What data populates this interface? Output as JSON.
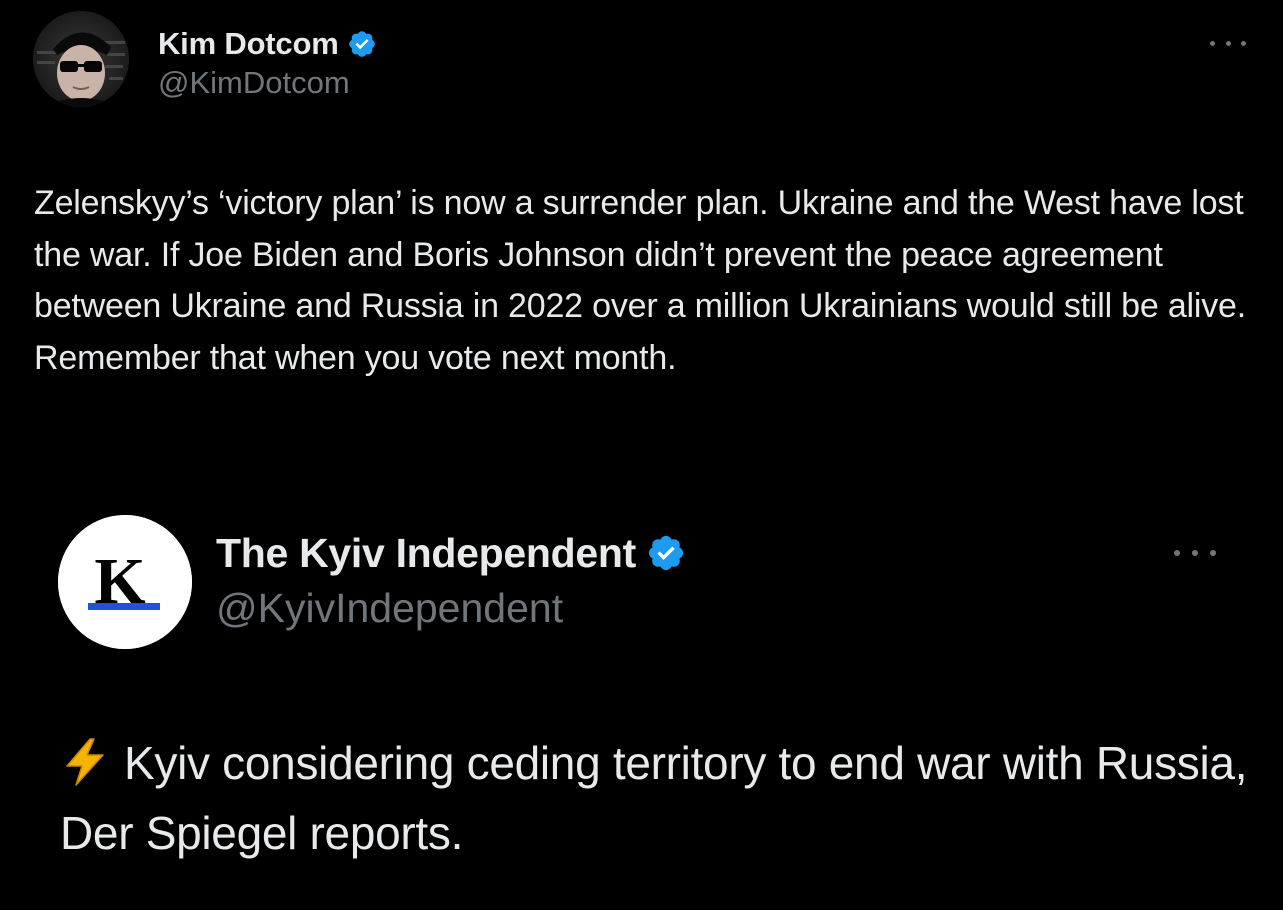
{
  "tweet": {
    "author": {
      "name": "Kim Dotcom",
      "handle": "@KimDotcom",
      "verified": true,
      "avatar_icon": "avatar-photo"
    },
    "more_icon": "more-dots-icon",
    "text": "Zelenskyy’s ‘victory plan’ is now a surrender plan. Ukraine and the West have lost the war. If Joe Biden and Boris Johnson didn’t prevent the peace agreement between Ukraine and Russia in 2022 over a million Ukrainians would still be alive. Remember that when you vote next month."
  },
  "quoted_tweet": {
    "author": {
      "name": "The Kyiv Independent",
      "handle": "@KyivIndependent",
      "verified": true,
      "avatar_letter": "K"
    },
    "more_icon": "more-dots-icon",
    "emoji_icon": "lightning-bolt-icon",
    "text": "Kyiv considering ceding territory to end war with Russia, Der Spiegel reports."
  },
  "colors": {
    "background": "#000000",
    "primary_text": "#e7e9ea",
    "secondary_text": "#71767b",
    "verified_blue": "#1d9bf0",
    "kyiv_blue": "#1f52d6"
  }
}
